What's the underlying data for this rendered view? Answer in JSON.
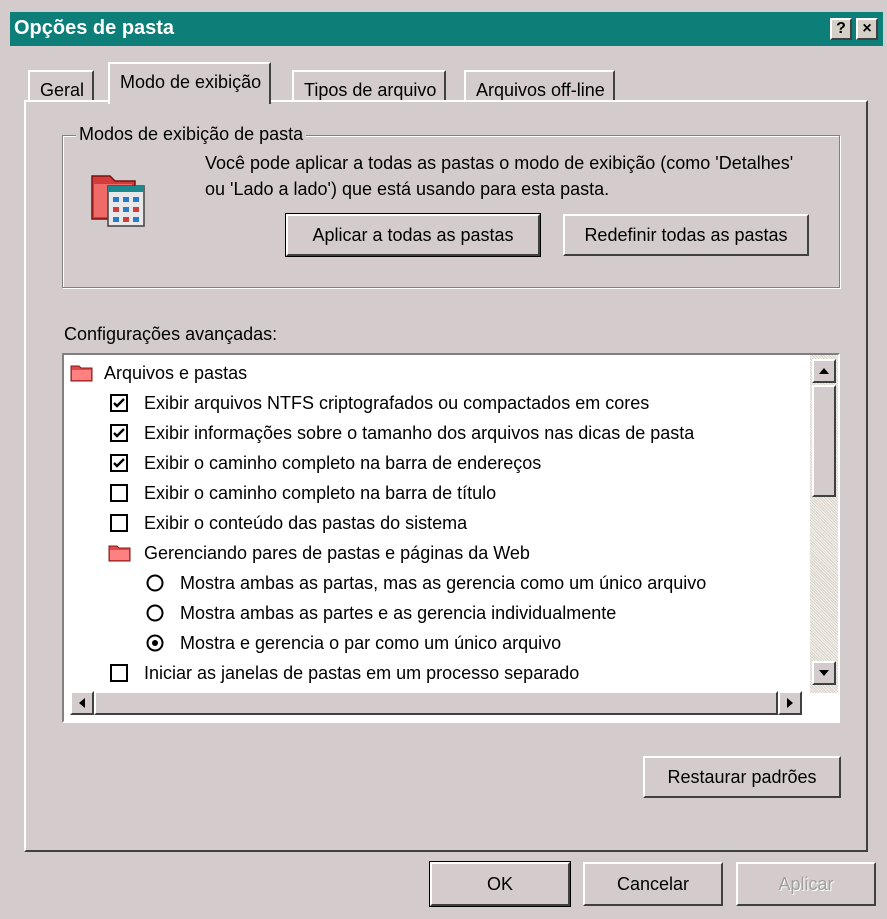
{
  "window": {
    "title": "Opções de pasta",
    "help_label": "?",
    "close_label": "×"
  },
  "tabs": [
    {
      "label": "Geral"
    },
    {
      "label": "Modo de exibição"
    },
    {
      "label": "Tipos de arquivo"
    },
    {
      "label": "Arquivos off-line"
    }
  ],
  "active_tab": "Modo de exibição",
  "folder_views": {
    "group_label": "Modos de exibição de pasta",
    "description": "Você pode aplicar a todas as pastas o modo de exibição (como 'Detalhes' ou 'Lado a lado') que está usando para esta pasta.",
    "apply_all_label": "Aplicar a todas as pastas",
    "reset_all_label": "Redefinir todas as pastas"
  },
  "advanced": {
    "label": "Configurações avançadas:",
    "items": [
      {
        "type": "folder",
        "text": "Arquivos e pastas",
        "level": 0
      },
      {
        "type": "checkbox",
        "text": "Exibir arquivos NTFS criptografados ou compactados em cores",
        "checked": true,
        "level": 1
      },
      {
        "type": "checkbox",
        "text": "Exibir informações sobre o tamanho dos arquivos nas dicas de pasta",
        "checked": true,
        "level": 1
      },
      {
        "type": "checkbox",
        "text": "Exibir o caminho completo na barra de endereços",
        "checked": true,
        "level": 1
      },
      {
        "type": "checkbox",
        "text": "Exibir o caminho completo na barra de título",
        "checked": false,
        "level": 1
      },
      {
        "type": "checkbox",
        "text": "Exibir o conteúdo das pastas do sistema",
        "checked": false,
        "level": 1
      },
      {
        "type": "folder",
        "text": "Gerenciando pares de pastas e páginas da Web",
        "level": 1
      },
      {
        "type": "radio",
        "text": "Mostra ambas as partas, mas as gerencia como um único arquivo",
        "checked": false,
        "level": 2
      },
      {
        "type": "radio",
        "text": "Mostra ambas as partes e as gerencia individualmente",
        "checked": false,
        "level": 2
      },
      {
        "type": "radio",
        "text": "Mostra e gerencia o par como um único arquivo",
        "checked": true,
        "level": 2
      },
      {
        "type": "checkbox",
        "text": "Iniciar as janelas de pastas em um processo separado",
        "checked": false,
        "level": 1
      }
    ],
    "restore_label": "Restaurar padrões"
  },
  "footer": {
    "ok_label": "OK",
    "cancel_label": "Cancelar",
    "apply_label": "Aplicar"
  },
  "colors": {
    "titlebar": "#0e7f78",
    "face": "#d4cccc",
    "folder_icon": "#d23c3c"
  },
  "icons": {
    "folder_views": "folder-view-icon",
    "tree_folder": "folder-icon",
    "checkbox": "checkmark-icon",
    "radio": "radio-dot-icon"
  }
}
